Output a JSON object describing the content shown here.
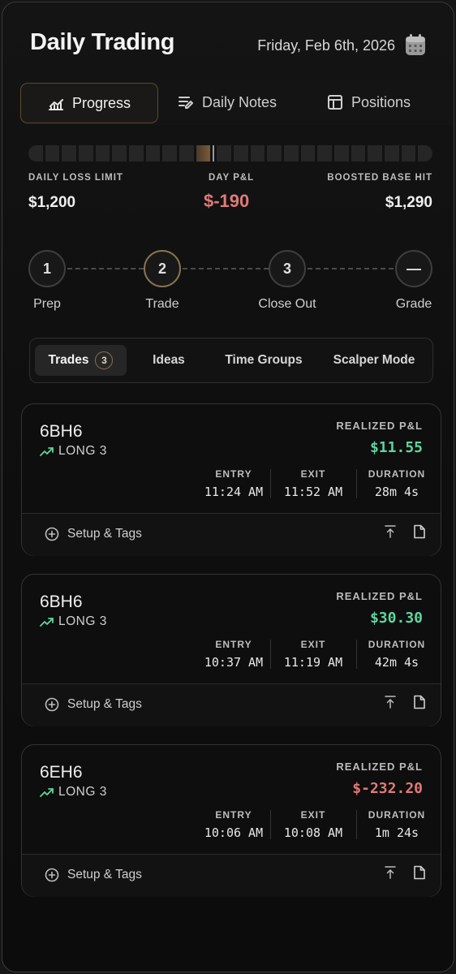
{
  "header": {
    "title": "Daily Trading",
    "date": "Friday, Feb 6th, 2026"
  },
  "tabs": [
    {
      "label": "Progress",
      "icon": "chart-line-icon",
      "active": true
    },
    {
      "label": "Daily Notes",
      "icon": "notes-pencil-icon",
      "active": false
    },
    {
      "label": "Positions",
      "icon": "table-layout-icon",
      "active": false
    }
  ],
  "progress": {
    "segments_total": 24,
    "filled_segment_index": 10,
    "daily_loss_limit_label": "DAILY LOSS LIMIT",
    "daily_loss_limit_value": "$1,200",
    "day_pnl_label": "DAY P&L",
    "day_pnl_value": "$-190",
    "boosted_label": "BOOSTED BASE HIT",
    "boosted_value": "$1,290",
    "colors": {
      "negative": "#e07a78",
      "positive": "#5fd4a0",
      "accent": "#8a7350"
    }
  },
  "steps": [
    {
      "num": "1",
      "label": "Prep"
    },
    {
      "num": "2",
      "label": "Trade",
      "current": true
    },
    {
      "num": "3",
      "label": "Close Out"
    },
    {
      "num": "—",
      "label": "Grade"
    }
  ],
  "subtabs": {
    "trades_label": "Trades",
    "trades_count": "3",
    "ideas": "Ideas",
    "time_groups": "Time Groups",
    "scalper_mode": "Scalper Mode"
  },
  "trades": [
    {
      "symbol": "6BH6",
      "direction": "LONG 3",
      "pnl_label": "REALIZED P&L",
      "pnl": "$11.55",
      "pnl_sign": "pos",
      "entry_label": "ENTRY",
      "entry": "11:24 AM",
      "exit_label": "EXIT",
      "exit": "11:52 AM",
      "duration_label": "DURATION",
      "duration": "28m 4s",
      "setup_label": "Setup & Tags"
    },
    {
      "symbol": "6BH6",
      "direction": "LONG 3",
      "pnl_label": "REALIZED P&L",
      "pnl": "$30.30",
      "pnl_sign": "pos",
      "entry_label": "ENTRY",
      "entry": "10:37 AM",
      "exit_label": "EXIT",
      "exit": "11:19 AM",
      "duration_label": "DURATION",
      "duration": "42m 4s",
      "setup_label": "Setup & Tags"
    },
    {
      "symbol": "6EH6",
      "direction": "LONG 3",
      "pnl_label": "REALIZED P&L",
      "pnl": "$-232.20",
      "pnl_sign": "neg",
      "entry_label": "ENTRY",
      "entry": "10:06 AM",
      "exit_label": "EXIT",
      "exit": "10:08 AM",
      "duration_label": "DURATION",
      "duration": "1m 24s",
      "setup_label": "Setup & Tags"
    }
  ]
}
